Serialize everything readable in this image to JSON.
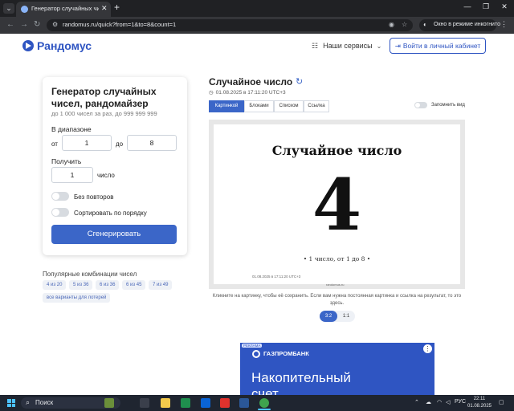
{
  "browser": {
    "tab_title": "Генератор случайных чисел, ра",
    "url": "randomus.ru/quick?from=1&to=8&count=1",
    "incognito_label": "Окно в режиме инкогнито"
  },
  "header": {
    "logo": "Рандомус",
    "services": "Наши сервисы",
    "login": "Войти в личный кабинет"
  },
  "card": {
    "title": "Генератор случайных чисел, рандомайзер",
    "subtitle": "до 1 000 чисел за раз, до 999 999 999",
    "range_label": "В диапазоне",
    "from_label": "от",
    "from_value": "1",
    "to_label": "до",
    "to_value": "8",
    "get_label": "Получить",
    "count_value": "1",
    "count_unit": "число",
    "no_repeat": "Без повторов",
    "sort": "Сортировать по порядку",
    "generate": "Сгенерировать"
  },
  "popular": {
    "title": "Популярные комбинации чисел",
    "chips": [
      "4 из 20",
      "5 из 36",
      "6 из 36",
      "6 из 45",
      "7 из 49",
      "все варианты для лотерей"
    ]
  },
  "result": {
    "title": "Случайное число",
    "date": "01.08.2025 в 17:11:20 UTC+3",
    "tabs": [
      "Картинкой",
      "Блоками",
      "Списком",
      "Ссылка"
    ],
    "remember": "Запомнить вид",
    "image_title": "Случайное число",
    "number": "4",
    "caption": "• 1 число, от 1 до 8 •",
    "image_date": "01.08.2025 в 17:11:20 UTC+3",
    "image_logo": "randomus.ru",
    "hint": "Кликните на картинку, чтобы её сохранить. Если вам нужна постоянная картинка и ссылка на результат, то это здесь.",
    "ratios": [
      "3:2",
      "1:1"
    ]
  },
  "ad": {
    "tag": "РЕКЛАМА",
    "brand": "ГАЗПРОМБАНК",
    "headline": "Накопительный",
    "headline2": "счет"
  },
  "taskbar": {
    "search": "Поиск",
    "lang": "РУС",
    "time": "22:11",
    "date": "01.08.2025"
  },
  "colors": {
    "accent": "#3b66c8",
    "brand": "#2f55c2"
  }
}
